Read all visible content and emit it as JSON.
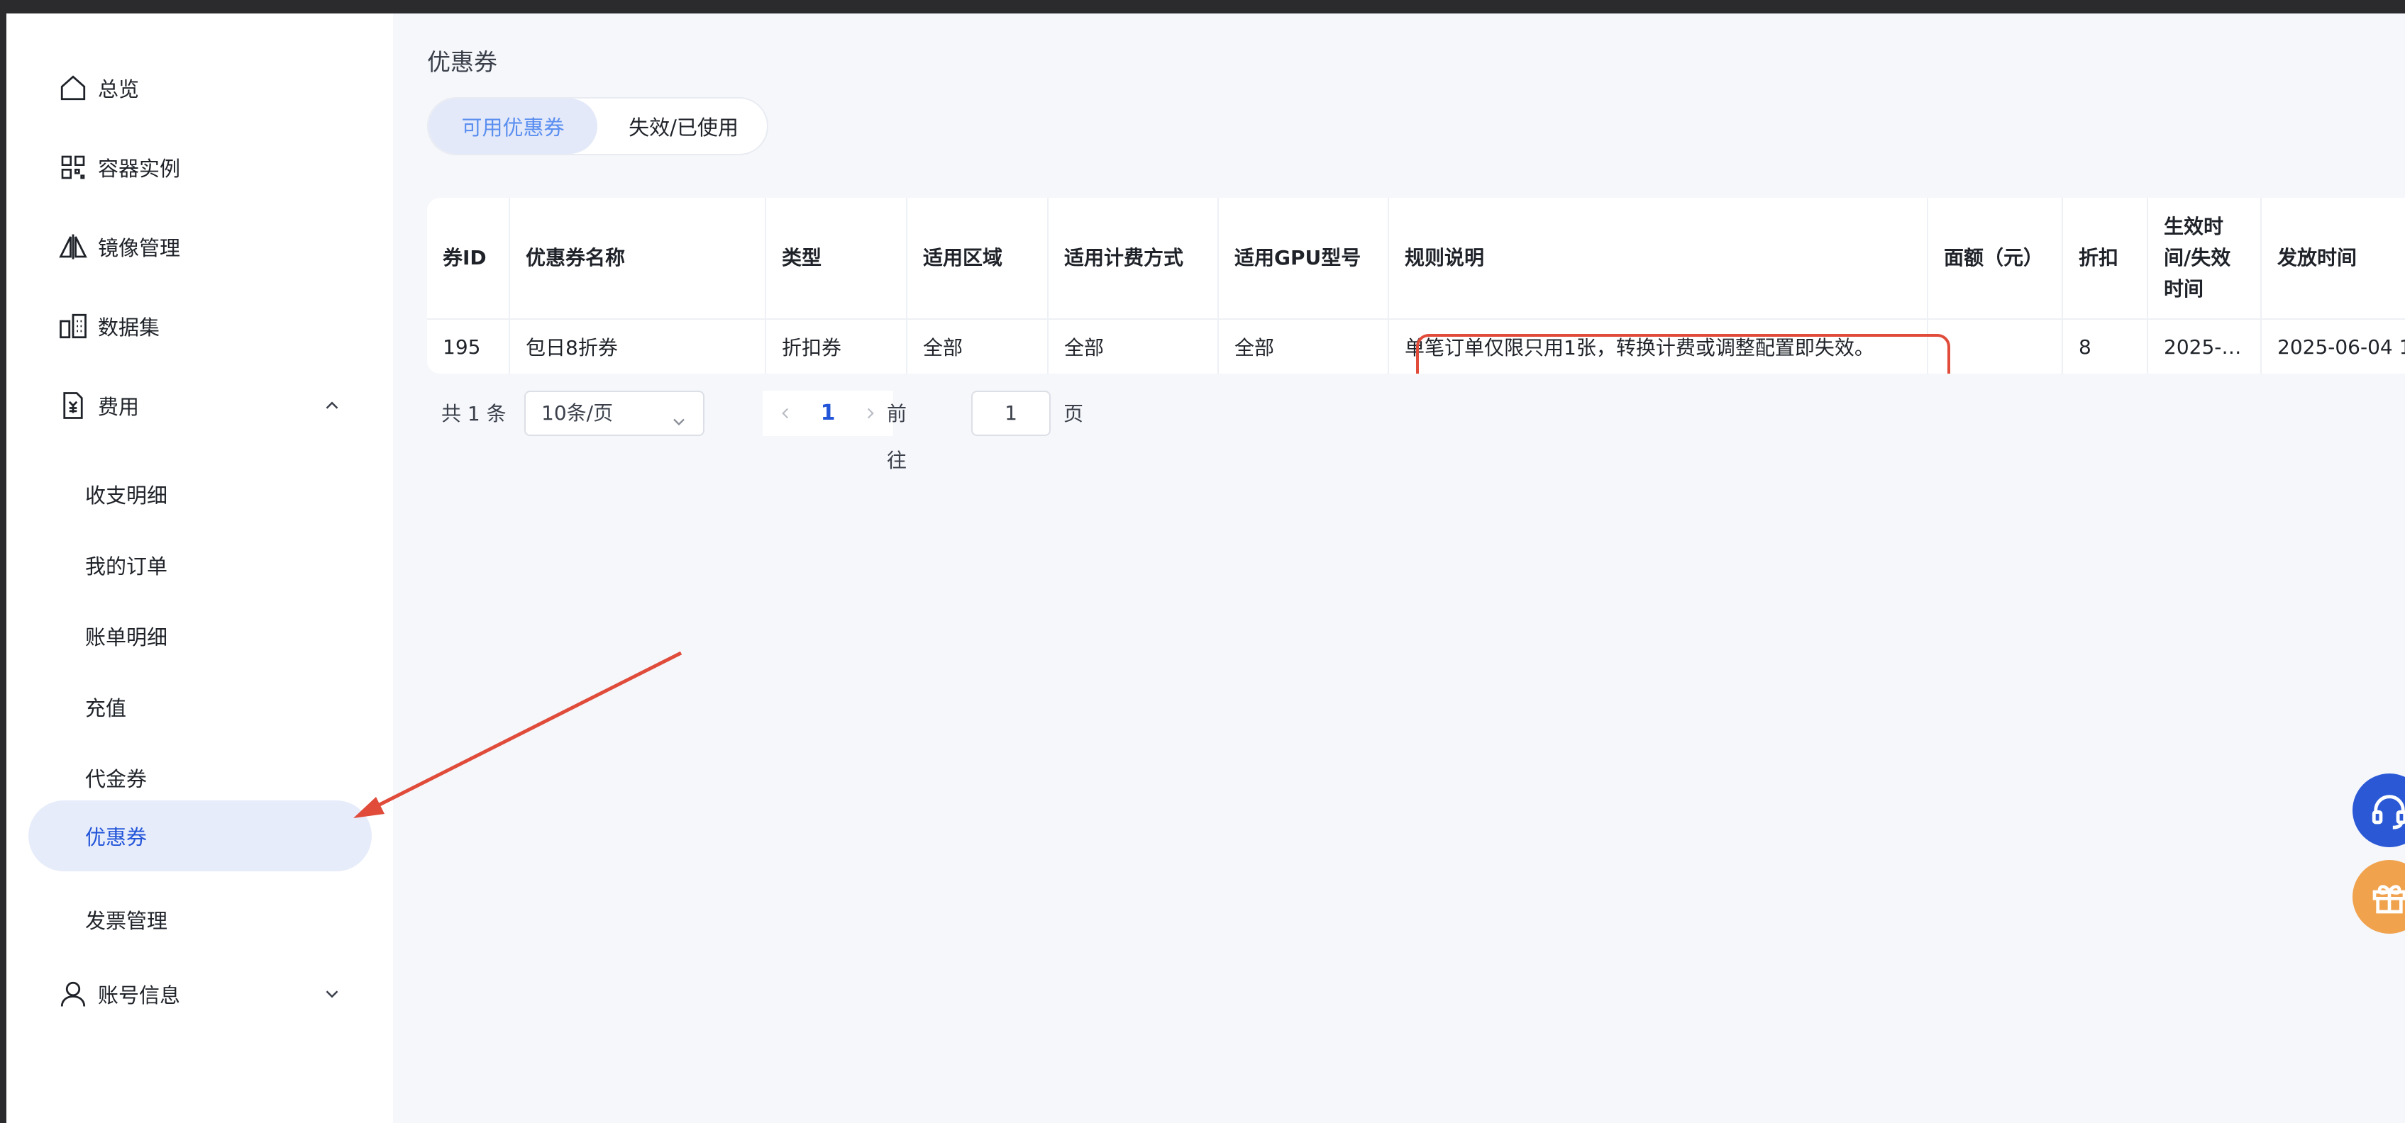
{
  "sidebar": {
    "items": [
      {
        "label": "总览",
        "icon": "home-icon"
      },
      {
        "label": "容器实例",
        "icon": "grid-icon"
      },
      {
        "label": "镜像管理",
        "icon": "mirror-icon"
      },
      {
        "label": "数据集",
        "icon": "dataset-icon"
      },
      {
        "label": "费用",
        "icon": "invoice-icon",
        "expanded": true
      },
      {
        "label": "账号信息",
        "icon": "user-icon",
        "expanded": false
      }
    ],
    "fee_children": [
      {
        "label": "收支明细"
      },
      {
        "label": "我的订单"
      },
      {
        "label": "账单明细"
      },
      {
        "label": "充值"
      },
      {
        "label": "代金券"
      },
      {
        "label": "优惠券",
        "active": true
      },
      {
        "label": "发票管理"
      }
    ]
  },
  "main": {
    "title": "优惠券",
    "tabs": [
      {
        "label": "可用优惠券",
        "active": true
      },
      {
        "label": "失效/已使用",
        "active": false
      }
    ],
    "table": {
      "headers": [
        "券ID",
        "优惠券名称",
        "类型",
        "适用区域",
        "适用计费方式",
        "适用GPU型号",
        "规则说明",
        "面额（元）",
        "折扣",
        "生效时间/失效时间",
        "发放时间"
      ],
      "rows": [
        [
          "195",
          "包日8折券",
          "折扣券",
          "全部",
          "全部",
          "全部",
          "单笔订单仅限只用1张，转换计费或调整配置即失效。",
          "",
          "8",
          "2025-…",
          "2025-06-04 1"
        ]
      ]
    },
    "pagination": {
      "total": "共 1 条",
      "page_size": "10条/页",
      "current_page": "1",
      "goto_label": "前往",
      "goto_value": "1",
      "page_word": "页"
    }
  },
  "colors": {
    "accent": "#2355d9",
    "active_bg": "#e6ecfa",
    "highlight": "#e04b3a",
    "support_button": "#2b59d6",
    "gift_button": "#f0a24d"
  }
}
